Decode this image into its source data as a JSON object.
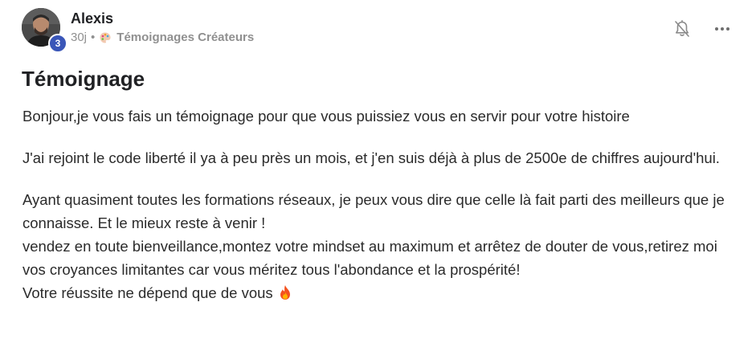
{
  "author": {
    "name": "Alexis",
    "level": "3"
  },
  "post_meta": {
    "time_ago": "30j",
    "separator": "•",
    "category_icon": "palette-icon",
    "category": "Témoignages Créateurs"
  },
  "actions": {
    "bell_icon": "bell-off-icon",
    "more_icon": "more-horizontal-icon"
  },
  "post": {
    "title": "Témoignage",
    "paragraphs": {
      "p1": "Bonjour,je vous fais un témoignage pour que vous puissiez vous en servir pour votre histoire",
      "p2": "J'ai rejoint le code liberté il ya à peu près un mois, et j'en suis déjà à plus de 2500e de chiffres aujourd'hui.",
      "p3_l1": "Ayant quasiment toutes les formations réseaux, je peux vous dire que celle là fait parti des meilleurs que je connaisse. Et le mieux reste à venir !",
      "p3_l2": "vendez en toute bienveillance,montez votre mindset au maximum et arrêtez de douter de vous,retirez moi vos croyances limitantes car vous méritez tous l'abondance et la prospérité!",
      "p3_l3": "Votre réussite ne dépend que de vous",
      "p3_l3_emoji": "fire-emoji-icon"
    }
  },
  "colors": {
    "badge": "#3a56b8",
    "meta_text": "#909090",
    "body_text": "#2b2b2b"
  }
}
